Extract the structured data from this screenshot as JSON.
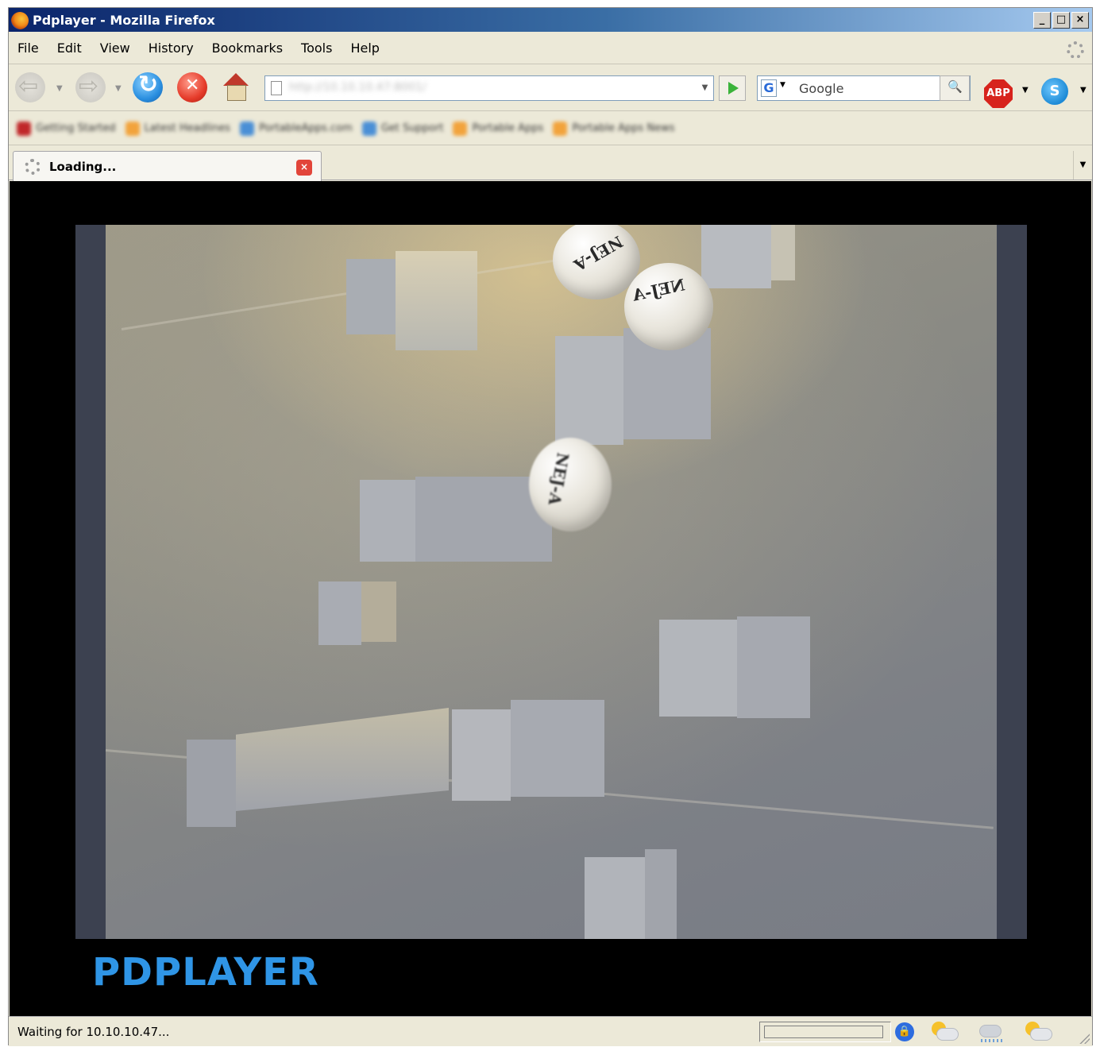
{
  "window": {
    "title": "Pdplayer - Mozilla Firefox",
    "controls": [
      "_",
      "□",
      "×"
    ]
  },
  "menu": {
    "items": [
      "File",
      "Edit",
      "View",
      "History",
      "Bookmarks",
      "Tools",
      "Help"
    ]
  },
  "toolbar": {
    "url": "http://10.10.10.47:8001/",
    "search_engine": "G",
    "search_placeholder": "Google",
    "abp_label": "ABP",
    "skype_label": "S"
  },
  "bookmarks": [
    {
      "label": "Getting Started",
      "color": "#c0282a"
    },
    {
      "label": "Latest Headlines",
      "color": "#f2a33c"
    },
    {
      "label": "PortableApps.com",
      "color": "#4a8fd6"
    },
    {
      "label": "Get Support",
      "color": "#4a8fd6"
    },
    {
      "label": "Portable Apps",
      "color": "#f2a33c"
    },
    {
      "label": "Portable Apps News",
      "color": "#f2a33c"
    }
  ],
  "tab": {
    "title": "Loading...",
    "close": "×"
  },
  "page": {
    "logo": "PDPLAYER",
    "ball_text": "NEJ-A"
  },
  "status": {
    "text": "Waiting for 10.10.10.47..."
  },
  "colors": {
    "logo": "#2f95e6",
    "title_bar": "#0a246a"
  }
}
